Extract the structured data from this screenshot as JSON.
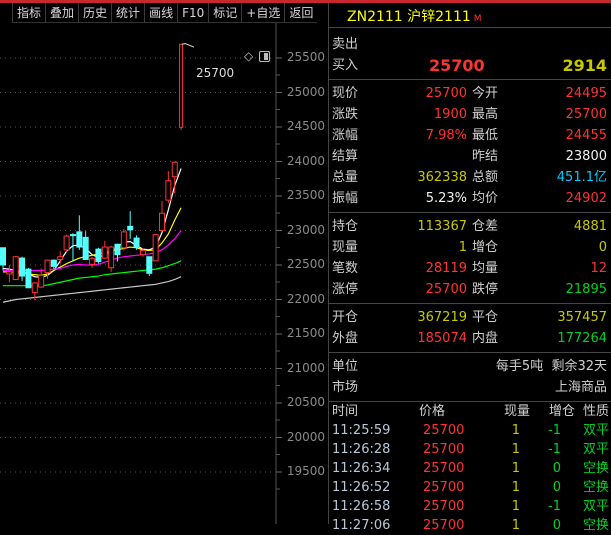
{
  "toolbar": [
    "指标",
    "叠加",
    "历史",
    "统计",
    "画线",
    "F10",
    "标记",
    "+自选",
    "返回"
  ],
  "chart": {
    "peak_label": "25700",
    "y_ticks": [
      "25500",
      "25000",
      "24500",
      "24000",
      "23500",
      "23000",
      "22500",
      "22000",
      "21500",
      "21000",
      "20500",
      "20000",
      "19500"
    ],
    "colors": {
      "up": "#ff3232",
      "down": "#54ffff",
      "ma5": "#ffffff",
      "ma10": "#ffff00",
      "ma20": "#ff00ff",
      "ma40": "#00ff00",
      "ma60": "#c8c8c8"
    }
  },
  "chart_data": {
    "type": "candlestick",
    "ylim": [
      19300,
      25900
    ],
    "candles": [
      [
        22750,
        22750,
        22420,
        22500
      ],
      [
        22370,
        22500,
        22250,
        22400
      ],
      [
        22290,
        22630,
        22280,
        22620
      ],
      [
        22600,
        22620,
        22270,
        22340
      ],
      [
        22440,
        22460,
        22170,
        22170
      ],
      [
        22100,
        22250,
        21990,
        22240
      ],
      [
        22180,
        22450,
        22170,
        22350
      ],
      [
        22390,
        22580,
        22300,
        22570
      ],
      [
        22570,
        22580,
        22440,
        22480
      ],
      [
        22580,
        22700,
        22520,
        22620
      ],
      [
        22720,
        22940,
        22690,
        22920
      ],
      [
        22940,
        22960,
        22550,
        22930
      ],
      [
        22980,
        23220,
        22720,
        22760
      ],
      [
        22900,
        22990,
        22580,
        22580
      ],
      [
        22510,
        22620,
        22460,
        22590
      ],
      [
        22730,
        22750,
        22520,
        22550
      ],
      [
        22600,
        22850,
        22590,
        22760
      ],
      [
        22460,
        22780,
        22400,
        22760
      ],
      [
        22800,
        22810,
        22550,
        22650
      ],
      [
        22750,
        23020,
        22710,
        22980
      ],
      [
        23060,
        23280,
        22880,
        23010
      ],
      [
        22890,
        22930,
        22720,
        22760
      ],
      [
        22650,
        22740,
        22620,
        22710
      ],
      [
        22620,
        22620,
        22340,
        22380
      ],
      [
        22560,
        22950,
        22560,
        22940
      ],
      [
        23000,
        23430,
        22990,
        23250
      ],
      [
        23440,
        23860,
        23400,
        23720
      ],
      [
        23780,
        24000,
        23540,
        23990
      ],
      [
        24495,
        25700,
        24455,
        25700
      ]
    ],
    "ma": {
      "ma5": [
        22450,
        22440,
        22420,
        22400,
        22370,
        22330,
        22320,
        22350,
        22420,
        22560,
        22700,
        22780,
        22790,
        22740,
        22650,
        22610,
        22650,
        22700,
        22760,
        22830,
        22840,
        22780,
        22730,
        22720,
        22760,
        22970,
        23300,
        23650,
        23900
      ],
      "ma10": [
        22400,
        22400,
        22390,
        22380,
        22370,
        22360,
        22350,
        22370,
        22420,
        22470,
        22520,
        22560,
        22600,
        22620,
        22640,
        22660,
        22680,
        22700,
        22720,
        22740,
        22760,
        22750,
        22720,
        22710,
        22720,
        22820,
        22950,
        23150,
        23330
      ],
      "ma20": [
        22420,
        22420,
        22420,
        22420,
        22420,
        22420,
        22420,
        22430,
        22440,
        22450,
        22480,
        22500,
        22510,
        22500,
        22500,
        22510,
        22540,
        22570,
        22600,
        22620,
        22630,
        22640,
        22650,
        22660,
        22680,
        22720,
        22790,
        22880,
        23000
      ],
      "ma40": [
        22200,
        22200,
        22200,
        22200,
        22200,
        22200,
        22200,
        22210,
        22230,
        22250,
        22270,
        22290,
        22310,
        22320,
        22330,
        22340,
        22360,
        22370,
        22380,
        22390,
        22400,
        22410,
        22420,
        22430,
        22440,
        22460,
        22490,
        22520,
        22560
      ],
      "ma60": [
        21960,
        21980,
        22000,
        22010,
        22020,
        22030,
        22040,
        22050,
        22060,
        22070,
        22080,
        22090,
        22100,
        22110,
        22120,
        22130,
        22140,
        22150,
        22160,
        22170,
        22180,
        22190,
        22200,
        22210,
        22220,
        22240,
        22260,
        22290,
        22330
      ]
    }
  },
  "panel": {
    "title": "ZN2111 沪锌2111",
    "badge": "M",
    "sell_label": "卖出",
    "buy_label": "买入",
    "buy_price": "25700",
    "buy_vol": "2914",
    "q1": [
      [
        "现价",
        "25700",
        "今开",
        "24495"
      ],
      [
        "涨跌",
        "1900",
        "最高",
        "25700"
      ],
      [
        "涨幅",
        "7.98%",
        "最低",
        "24455"
      ],
      [
        "结算",
        "",
        "昨结",
        "23800"
      ],
      [
        "总量",
        "362338",
        "总额",
        "451.1亿"
      ],
      [
        "振幅",
        "5.23%",
        "均价",
        "24902"
      ]
    ],
    "q2": [
      [
        "持仓",
        "113367",
        "仓差",
        "4881"
      ],
      [
        "现量",
        "1",
        "增仓",
        "0"
      ],
      [
        "笔数",
        "28119",
        "均量",
        "12"
      ],
      [
        "涨停",
        "25700",
        "跌停",
        "21895"
      ]
    ],
    "q3": [
      [
        "开仓",
        "367219",
        "平仓",
        "357457"
      ],
      [
        "外盘",
        "185074",
        "内盘",
        "177264"
      ]
    ],
    "unit_label": "单位",
    "unit_value": "每手5吨  剩余32天",
    "market_label": "市场",
    "market_value": "上海商品",
    "ticks_header": [
      "时间",
      "价格",
      "现量",
      "增仓",
      "性质"
    ],
    "ticks": [
      [
        "11:25:59",
        "25700",
        "1",
        "-1",
        "双平"
      ],
      [
        "11:26:28",
        "25700",
        "1",
        "-1",
        "双平"
      ],
      [
        "11:26:34",
        "25700",
        "1",
        "0",
        "空换"
      ],
      [
        "11:26:52",
        "25700",
        "1",
        "0",
        "空换"
      ],
      [
        "11:26:58",
        "25700",
        "1",
        "-1",
        "双平"
      ],
      [
        "11:27:06",
        "25700",
        "1",
        "0",
        "空换"
      ]
    ]
  }
}
